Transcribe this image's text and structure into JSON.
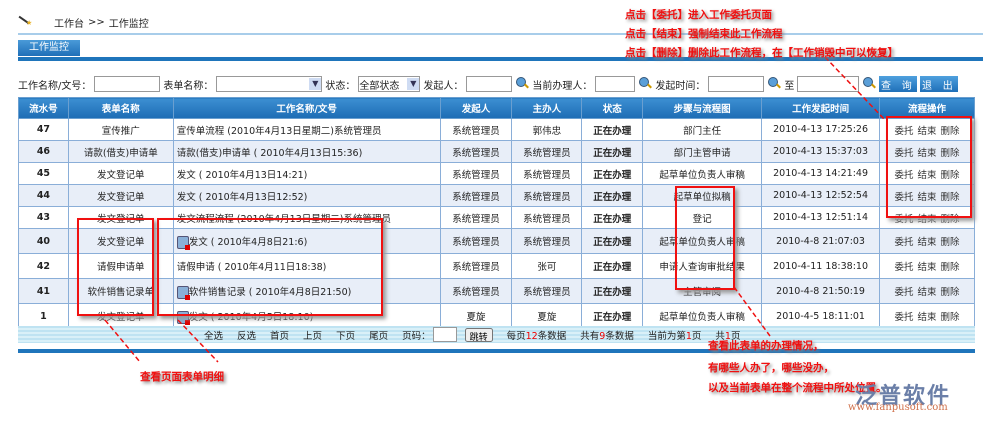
{
  "breadcrumb": {
    "home": "工作台",
    "sep": ">>",
    "current": "工作监控"
  },
  "tab": "工作监控",
  "filters": {
    "work_name_label": "工作名称/文号：",
    "work_name_value": "",
    "form_name_label": "表单名称：",
    "form_name_value": "",
    "status_label": "状态：",
    "status_value": "全部状态",
    "initiator_label": "发起人：",
    "handler_label": "当前办理人：",
    "start_time_label": "发起时间：",
    "to_label": "至",
    "search_button": "查 询",
    "exit_button": "退 出"
  },
  "table": {
    "headers": [
      "流水号",
      "表单名称",
      "工作名称/文号",
      "发起人",
      "主办人",
      "状态",
      "步骤与流程图",
      "工作发起时间",
      "流程操作"
    ],
    "rows": [
      {
        "id": "47",
        "form": "宣传推广",
        "work": "宣传单流程 (2010年4月13日星期二)系统管理员",
        "icon": false,
        "initiator": "系统管理员",
        "handler": "郭伟忠",
        "status": "正在办理",
        "step": "部门主任",
        "time": "2010-4-13 17:25:26"
      },
      {
        "id": "46",
        "form": "请款(借支)申请单",
        "work": "请款(借支)申请单 ( 2010年4月13日15:36)",
        "icon": false,
        "initiator": "系统管理员",
        "handler": "系统管理员",
        "status": "正在办理",
        "step": "部门主管申请",
        "time": "2010-4-13 15:37:03"
      },
      {
        "id": "45",
        "form": "发文登记单",
        "work": "发文 ( 2010年4月13日14:21)",
        "icon": false,
        "initiator": "系统管理员",
        "handler": "系统管理员",
        "status": "正在办理",
        "step": "起草单位负责人审稿",
        "time": "2010-4-13 14:21:49"
      },
      {
        "id": "44",
        "form": "发文登记单",
        "work": "发文 ( 2010年4月13日12:52)",
        "icon": false,
        "initiator": "系统管理员",
        "handler": "系统管理员",
        "status": "正在办理",
        "step": "起草单位拟稿",
        "time": "2010-4-13 12:52:54"
      },
      {
        "id": "43",
        "form": "发文登记单",
        "work": "发文流程流程 (2010年4月13日星期二)系统管理员",
        "icon": false,
        "initiator": "系统管理员",
        "handler": "系统管理员",
        "status": "正在办理",
        "step": "登记",
        "time": "2010-4-13 12:51:14"
      },
      {
        "id": "40",
        "form": "发文登记单",
        "work": "发文 ( 2010年4月8日21:6)",
        "icon": true,
        "initiator": "系统管理员",
        "handler": "系统管理员",
        "status": "正在办理",
        "step": "起草单位负责人审稿",
        "time": "2010-4-8 21:07:03"
      },
      {
        "id": "42",
        "form": "请假申请单",
        "work": "请假申请 ( 2010年4月11日18:38)",
        "icon": false,
        "initiator": "系统管理员",
        "handler": "张可",
        "status": "正在办理",
        "step": "申请人查询审批结果",
        "time": "2010-4-11 18:38:10"
      },
      {
        "id": "41",
        "form": "软件销售记录单",
        "work": "软件销售记录 ( 2010年4月8日21:50)",
        "icon": true,
        "initiator": "系统管理员",
        "handler": "系统管理员",
        "status": "正在办理",
        "step": "主管审阅",
        "time": "2010-4-8 21:50:19"
      },
      {
        "id": "1",
        "form": "发文登记单",
        "work": "发文 ( 2010年4月5日18:10)",
        "icon": true,
        "initiator": "夏旋",
        "handler": "夏旋",
        "status": "正在办理",
        "step": "起草单位负责人审稿",
        "time": "2010-4-5 18:11:01"
      }
    ],
    "ops": [
      "委托",
      "结束",
      "删除"
    ]
  },
  "pager": {
    "select_all": "全选",
    "invert": "反选",
    "first": "首页",
    "prev": "上页",
    "next": "下页",
    "last": "尾页",
    "page_label": "页码：",
    "jump": "跳转",
    "per_page_pre": "每页",
    "per_page": "12",
    "per_page_post": "条数据",
    "total_pre": "共有",
    "total": "9",
    "total_post": "条数据",
    "current_pre": "当前为第",
    "current": "1",
    "current_post": "页",
    "pages_pre": "共",
    "pages": "1",
    "pages_post": "页"
  },
  "annotations": {
    "top": [
      "点击【委托】进入工作委托页面",
      "点击【结束】强制结束此工作流程",
      "点击【删除】删除此工作流程，在【工作销毁中可以恢复】"
    ],
    "bottom_left": "查看页面表单明细",
    "bottom_right": [
      "查看此表单的办理情况，",
      "有哪些人办了，哪些没办，",
      "以及当前表单在整个流程中所处位置。"
    ]
  },
  "logo": {
    "name": "泛普软件",
    "url": "www.fanpusoft.com"
  },
  "colors": {
    "header_blue": "#1f75bb",
    "annotation_red": "#f01010"
  }
}
